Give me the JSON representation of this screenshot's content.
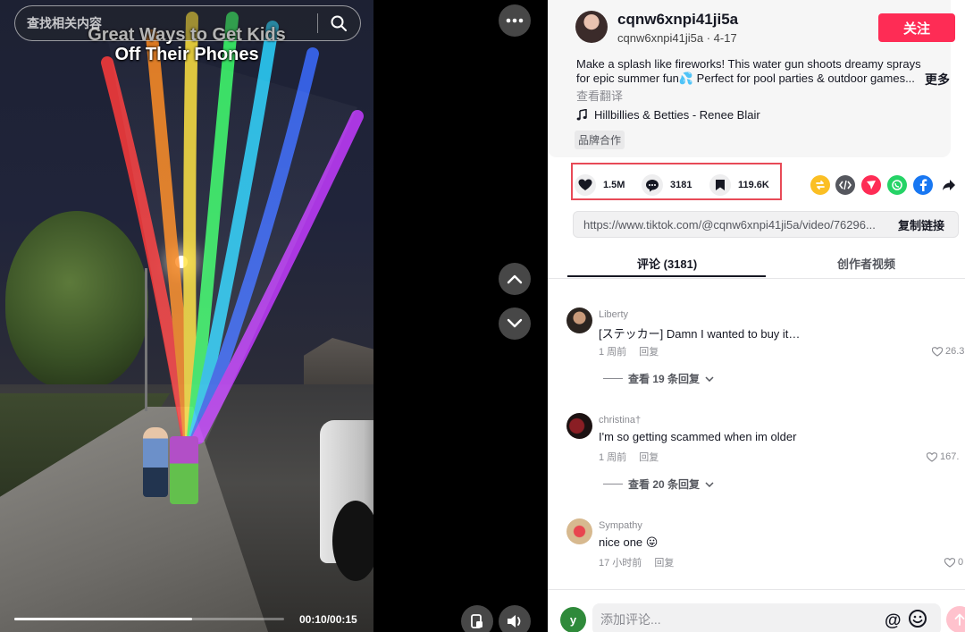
{
  "video": {
    "search_placeholder": "查找相关内容",
    "title_line1": "Great Ways to Get Kids",
    "title_line2": "Off Their Phones",
    "progress_fraction": 0.66,
    "time": "00:10/00:15"
  },
  "post": {
    "username": "cqnw6xnpi41ji5a",
    "handle_date": "cqnw6xnpi41ji5a · 4-17",
    "follow_label": "关注",
    "description": "Make a splash like fireworks! This water gun shoots dreamy sprays for epic summer fun💦 Perfect for pool parties & outdoor games...",
    "more_label": "更多",
    "translate_label": "查看翻译",
    "music": "Hillbillies & Betties - Renee Blair",
    "brand_tag": "品牌合作"
  },
  "stats": {
    "likes": "1.5M",
    "comments": "3181",
    "saves": "119.6K"
  },
  "share": {
    "icons": [
      "repost-icon",
      "embed-icon",
      "send-to-friends-icon",
      "whatsapp-icon",
      "facebook-icon",
      "share-arrow-icon"
    ],
    "colors": {
      "repost": "#fbbf24",
      "embed": "#55575e",
      "send": "#fe2c55",
      "whatsapp": "#25d366",
      "facebook": "#1877f2"
    }
  },
  "link": {
    "url": "https://www.tiktok.com/@cqnw6xnpi41ji5a/video/76296...",
    "copy_label": "复制链接"
  },
  "tabs": {
    "comments": "评论 (3181)",
    "creator_videos": "创作者视频"
  },
  "comments": [
    {
      "name": "Liberty",
      "text": "[ステッカー] Damn I wanted to buy it…",
      "time": "1 周前",
      "reply": "回复",
      "likes": "26.3",
      "view_replies": "查看 19 条回复"
    },
    {
      "name": "christina†",
      "text": "I'm so getting scammed when im older",
      "time": "1 周前",
      "reply": "回复",
      "likes": "167.",
      "view_replies": "查看 20 条回复"
    },
    {
      "name": "Sympathy",
      "text": "nice one 😛",
      "time": "17 小时前",
      "reply": "回复",
      "likes": "0",
      "view_replies": ""
    }
  ],
  "composer": {
    "avatar_letter": "y",
    "placeholder": "添加评论..."
  },
  "colors": {
    "accent": "#fe2c55",
    "highlight_box": "#e84a57"
  }
}
